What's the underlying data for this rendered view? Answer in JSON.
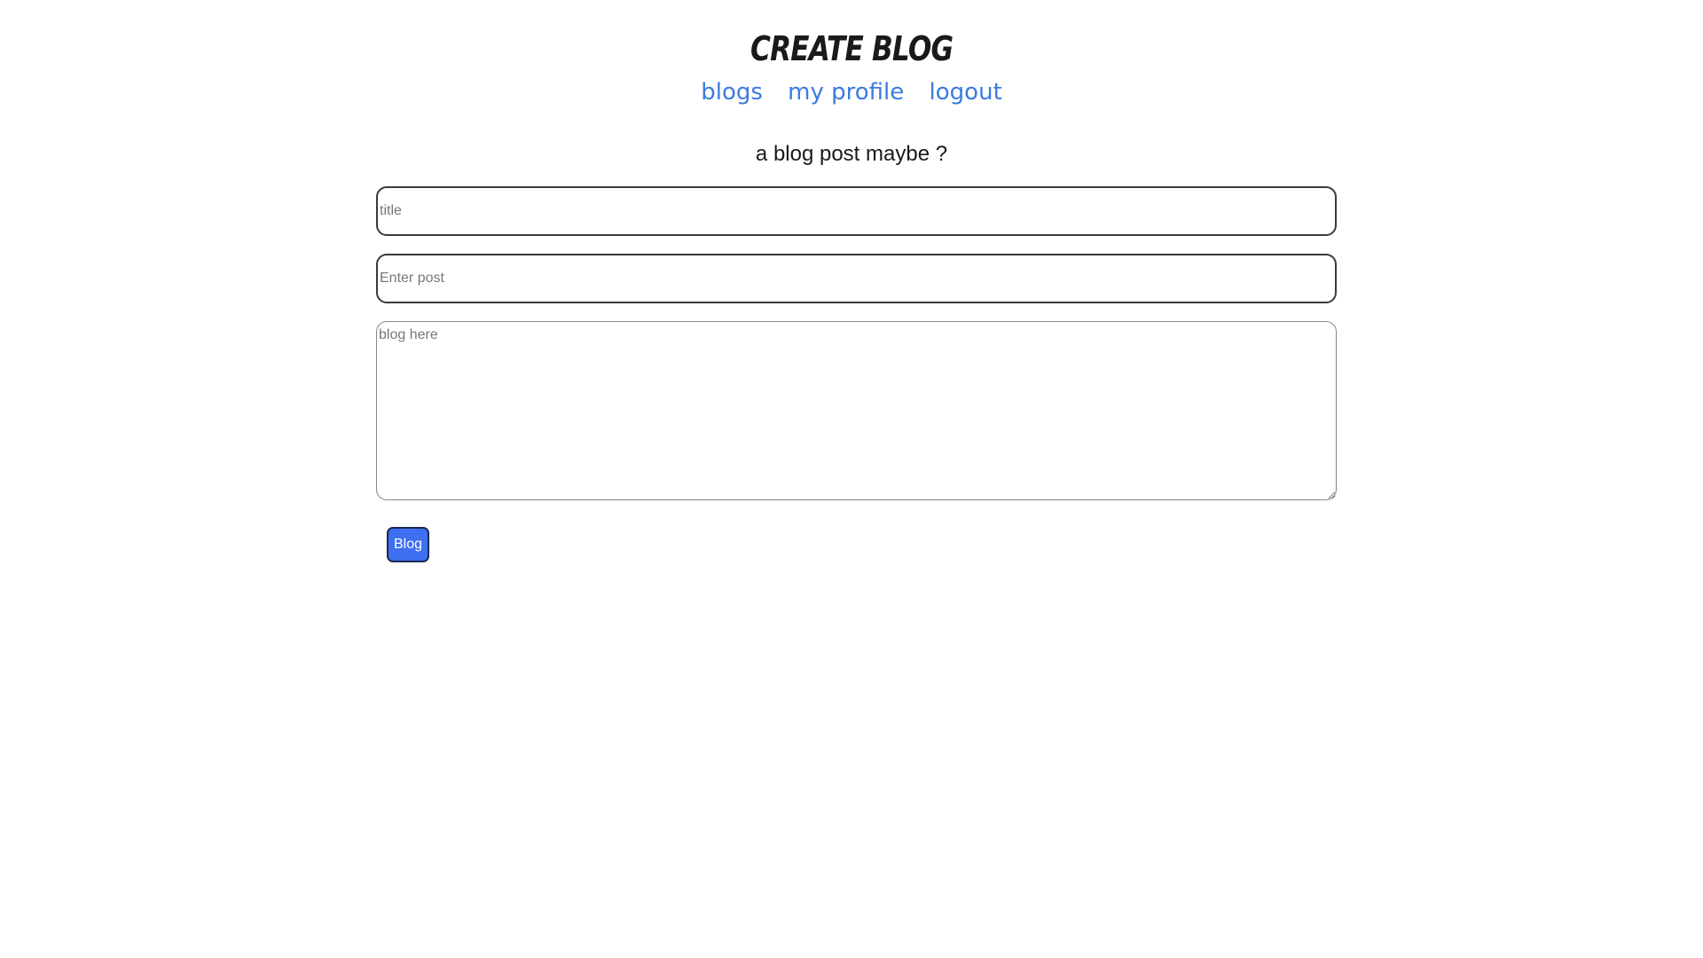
{
  "header": {
    "title": "CREATE BLOG"
  },
  "nav": {
    "items": [
      {
        "label": "blogs"
      },
      {
        "label": "my profile"
      },
      {
        "label": "logout"
      }
    ],
    "link_color": "#3b7be0"
  },
  "form": {
    "subtitle": "a blog post maybe ?",
    "title_input": {
      "value": "",
      "placeholder": "title"
    },
    "post_input": {
      "value": "",
      "placeholder": "Enter post"
    },
    "blog_textarea": {
      "value": "",
      "placeholder": "blog here"
    },
    "submit_label": "Blog",
    "submit_color": "#3d6ff0"
  }
}
